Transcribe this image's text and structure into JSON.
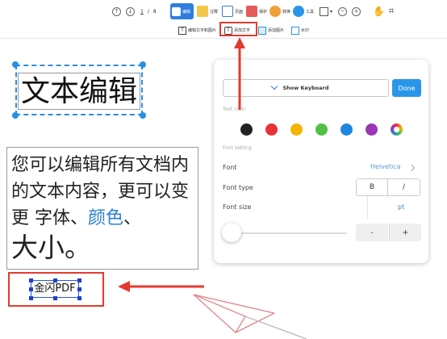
{
  "toolbar": {
    "edit_label": "编辑",
    "annotate_label": "注释",
    "page_label": "页面",
    "protect_label": "保护",
    "convert_label": "转换",
    "tools_label": "工具",
    "page_current": "1",
    "page_sep": "/",
    "page_total": "8"
  },
  "subbar": {
    "edit_text_image": "编辑文字和图片",
    "add_text": "添加文字",
    "add_image": "添加图片",
    "watermark": "水印"
  },
  "demo": {
    "title": "文本编辑",
    "para_1": "您可以编辑所有文档内的文本内容，更可以变更",
    "para_2": " 字体、",
    "para_blue": "颜色",
    "para_3": "、",
    "para_big": "大小。",
    "logo": "金闪PDF"
  },
  "panel": {
    "keyboard_label": "Show Keyboard",
    "done_label": "Done",
    "text_color_label": "Text color",
    "font_setting_label": "Font setting",
    "font_label": "Font",
    "font_value": "Helvetica",
    "font_type_label": "Font type",
    "bold_label": "B",
    "italic_label": "/",
    "font_size_label": "Font size",
    "size_unit": "pt",
    "minus_label": "-",
    "plus_label": "+"
  },
  "colors": {
    "accent": "#2f7de1",
    "highlight": "#e33b2e",
    "swatches": [
      "#222222",
      "#e8323a",
      "#f5b400",
      "#4fbf45",
      "#1f86e0",
      "#9b35b8"
    ]
  }
}
